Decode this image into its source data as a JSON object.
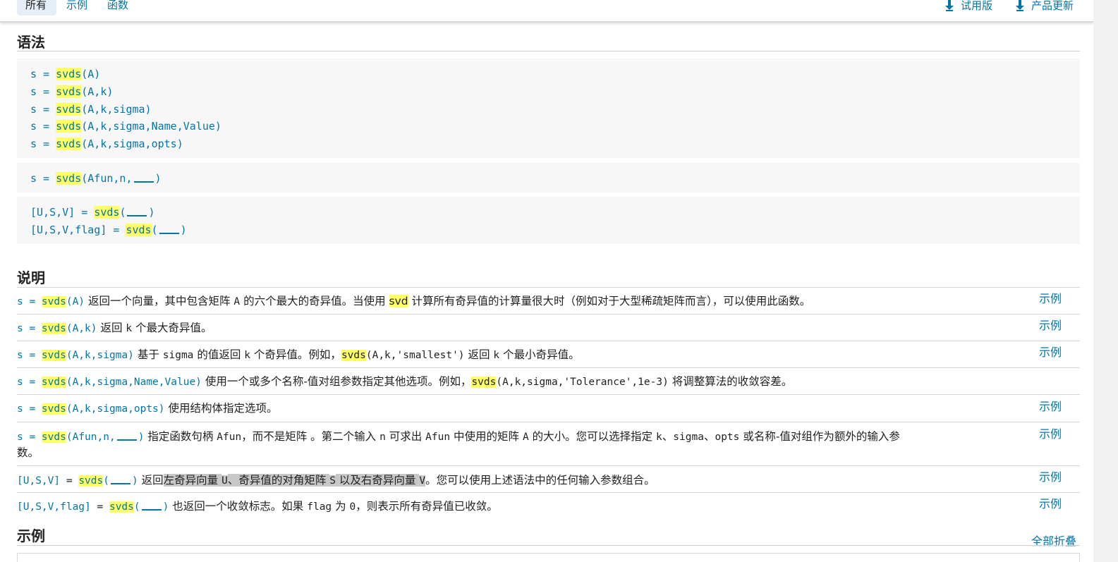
{
  "tabs": {
    "all": "所有",
    "examples": "示例",
    "functions": "函数"
  },
  "right_links": {
    "trial": "试用版",
    "updates": "产品更新"
  },
  "syntax": {
    "heading": "语法",
    "fn": "svds",
    "lines": [
      "s = ",
      "(A)",
      "(A,k)",
      "(A,k,sigma)",
      "(A,k,sigma,Name,Value)",
      "(A,k,sigma,opts)"
    ],
    "afun_args": "(Afun,n,",
    "usv_prefix": "[U,S,V] = ",
    "usvf_prefix": "[U,S,V,flag] = ",
    "open_paren": "(",
    "close_paren": ")"
  },
  "description": {
    "heading": "说明",
    "rows": [
      {
        "t1": "返回一个向量，其中包含矩阵 ",
        "t2": "A",
        "t3": " 的六个最大的奇异值。当使用 ",
        "svd": "svd",
        "t4": " 计算所有奇异值的计算量很大时（例如对于大型稀疏矩阵而言），可以使用此函数。",
        "link": "示例"
      },
      {
        "t1": "返回 ",
        "t2": "k",
        "t3": " 个最大奇异值。",
        "link": "示例"
      },
      {
        "t1": "基于 ",
        "t2": "sigma",
        "t3": " 的值返回 ",
        "t4": "k",
        "t5": " 个奇异值。例如，",
        "code": "(A,k,'smallest')",
        "t6": " 返回 ",
        "t7": "k",
        "t8": " 个最小奇异值。",
        "link": "示例"
      },
      {
        "t1": "使用一个或多个名称-值对组参数指定其他选项。例如，",
        "code": "(A,k,sigma,'Tolerance',1e-3)",
        "t2": " 将调整算法的收敛容差。"
      },
      {
        "t1": "使用结构体指定选项。",
        "link": "示例"
      },
      {
        "t1": "指定函数句柄 ",
        "c1": "Afun",
        "t2": "，而不是矩阵 。第二个输入 ",
        "c2": "n",
        "t3": " 可求出 ",
        "c3": "Afun",
        "t4": " 中使用的矩阵 ",
        "c4": "A",
        "t5": " 的大小。您可以选择指定 ",
        "c5": "k",
        "t6": "、",
        "c6": "sigma",
        "t7": "、",
        "c7": "opts",
        "t8": " 或名称-值对组作为额外的输入参",
        "t9": "数。",
        "link": "示例"
      },
      {
        "t1": "返回",
        "s1": "左奇异向量 ",
        "c1": "U",
        "s2": "、奇异值的对角矩阵 ",
        "c2": "S",
        "s3": " 以及右奇异向量 ",
        "c3": "V",
        "t2": "。您可以使用上述语法中的任何输入参数组合。",
        "link": "示例"
      },
      {
        "t1": "也返回一个收敛标志。如果 ",
        "c1": "flag",
        "t2": " 为 ",
        "c2": "0",
        "t3": "，则表示所有奇异值已收敛。",
        "link": "示例"
      }
    ]
  },
  "examples": {
    "heading": "示例",
    "collapse_all": "全部折叠"
  },
  "colors": {
    "link": "#0076a8",
    "highlight": "#ffff66",
    "code_bg": "#f7f7f7"
  }
}
